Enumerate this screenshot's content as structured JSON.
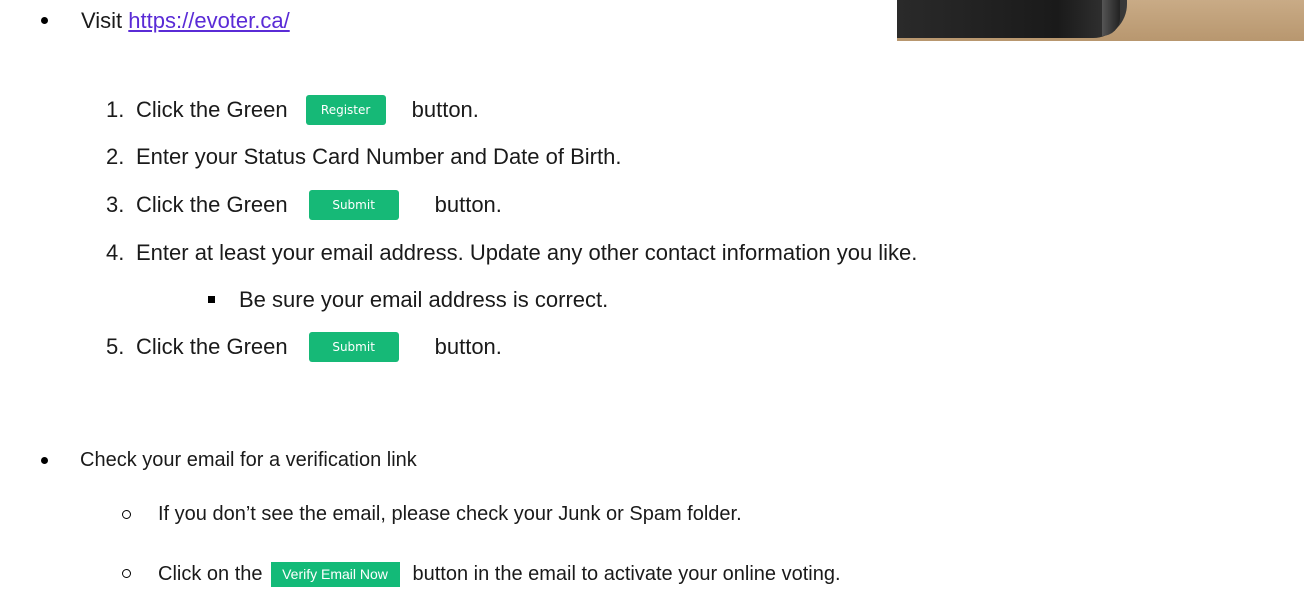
{
  "visit": {
    "prefix": "Visit",
    "url": "https://evoter.ca/"
  },
  "steps": [
    {
      "number": "1.",
      "before": "Click the Green",
      "button": "Register",
      "after": "button."
    },
    {
      "number": "2.",
      "text": "Enter your Status Card Number and Date of Birth."
    },
    {
      "number": "3.",
      "before": "Click the Green",
      "button": "Submit",
      "after": "button."
    },
    {
      "number": "4.",
      "text": "Enter at least your email address. Update any other contact information you like."
    },
    {
      "number": "5.",
      "before": "Click the Green",
      "button": "Submit",
      "after": "button."
    }
  ],
  "sub_note": "Be sure your email address is correct.",
  "check": {
    "text": "Check your email for a verification link",
    "sub_items": [
      {
        "text": "If you don’t see the email, please check your Junk or Spam folder."
      },
      {
        "before": "Click on the",
        "button": "Verify Email Now",
        "after": "button in the email to activate your online voting."
      }
    ]
  },
  "colors": {
    "button_green": "#16b977",
    "link": "#5a2bd6"
  }
}
